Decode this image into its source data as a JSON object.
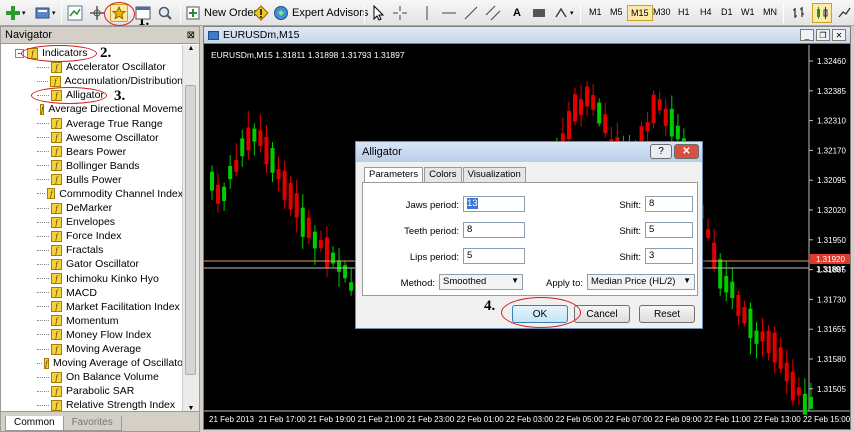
{
  "toolbar": {
    "new_order": "New Order",
    "expert_advisors": "Expert Advisors",
    "font_btn": "A",
    "timeframes": [
      "M1",
      "M5",
      "M15",
      "M30",
      "H1",
      "H4",
      "D1",
      "W1",
      "MN"
    ]
  },
  "callouts": [
    "1.",
    "2.",
    "3.",
    "4."
  ],
  "navigator": {
    "title": "Navigator",
    "close": "⊠",
    "root": "Indicators",
    "items": [
      "Accelerator Oscillator",
      "Accumulation/Distribution",
      "Alligator",
      "Average Directional Moveme",
      "Average True Range",
      "Awesome Oscillator",
      "Bears Power",
      "Bollinger Bands",
      "Bulls Power",
      "Commodity Channel Index",
      "DeMarker",
      "Envelopes",
      "Force Index",
      "Fractals",
      "Gator Oscillator",
      "Ichimoku Kinko Hyo",
      "MACD",
      "Market Facilitation Index",
      "Momentum",
      "Money Flow Index",
      "Moving Average",
      "Moving Average of Oscillato",
      "On Balance Volume",
      "Parabolic SAR",
      "Relative Strength Index"
    ],
    "tabs": [
      "Common",
      "Favorites"
    ]
  },
  "chart_window": {
    "title": "EURUSDm,M15",
    "info": "EURUSDm,M15  1.31811 1.31898 1.31793 1.31897",
    "current_price": "1.31920",
    "second_price": "1.31897",
    "price_labels": [
      "1.32460",
      "1.32385",
      "1.32310",
      "1.32170",
      "1.32095",
      "1.32020",
      "1.31950",
      "1.31805",
      "1.31730",
      "1.31655",
      "1.31580",
      "1.31505"
    ],
    "time_labels": [
      "21 Feb 2013",
      "21 Feb 17:00",
      "21 Feb 19:00",
      "21 Feb 21:00",
      "21 Feb 23:00",
      "22 Feb 01:00",
      "22 Feb 03:00",
      "22 Feb 05:00",
      "22 Feb 07:00",
      "22 Feb 09:00",
      "22 Feb 11:00",
      "22 Feb 13:00",
      "22 Feb 15:00"
    ]
  },
  "dialog": {
    "title": "Alligator",
    "help": "?",
    "close": "✕",
    "tabs": [
      "Parameters",
      "Colors",
      "Visualization"
    ],
    "jaws_label": "Jaws period:",
    "jaws_value": "13",
    "teeth_label": "Teeth period:",
    "teeth_value": "8",
    "lips_label": "Lips period:",
    "lips_value": "5",
    "shift_label": "Shift:",
    "shift_values": [
      "8",
      "5",
      "3"
    ],
    "method_label": "Method:",
    "method_value": "Smoothed",
    "apply_label": "Apply to:",
    "apply_value": "Median Price (HL/2)",
    "ok": "OK",
    "cancel": "Cancel",
    "reset": "Reset"
  },
  "colors": {
    "bull": "#00cc00",
    "bear": "#e00000",
    "annotation": "#d42020"
  }
}
